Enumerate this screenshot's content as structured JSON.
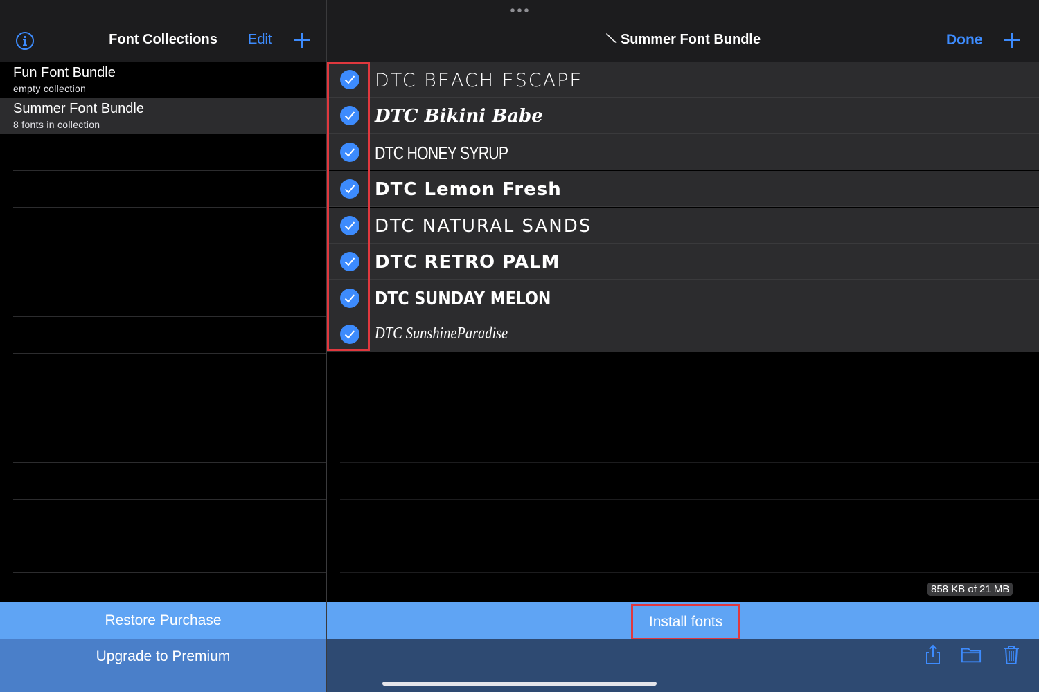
{
  "left_pane": {
    "header": {
      "title": "Font Collections",
      "edit_label": "Edit",
      "info_icon": "info-circle-icon",
      "add_icon": "plus-icon"
    },
    "collections": [
      {
        "name": "Fun Font Bundle",
        "subtitle": "empty collection",
        "selected": false
      },
      {
        "name": "Summer Font Bundle",
        "subtitle": "8 fonts in collection",
        "selected": true
      }
    ],
    "restore_label": "Restore Purchase",
    "upgrade_label": "Upgrade to Premium"
  },
  "right_pane": {
    "header": {
      "title": "Summer Font Bundle",
      "title_icon": "pen-icon",
      "done_label": "Done",
      "add_icon": "plus-icon",
      "more_icon": "ellipsis-icon"
    },
    "fonts": [
      {
        "name": "DTC BEACH ESCAPE",
        "checked": true
      },
      {
        "name": "DTC Bikini Babe",
        "checked": true
      },
      {
        "name": "DTC HONEY SYRUP",
        "checked": true
      },
      {
        "name": "DTC Lemon Fresh",
        "checked": true
      },
      {
        "name": "DTC NATURAL SANDS",
        "checked": true
      },
      {
        "name": "DTC RETRO PALM",
        "checked": true
      },
      {
        "name": "DTC SUNDAY MELON",
        "checked": true
      },
      {
        "name": "DTC SunshineParadise",
        "checked": true
      }
    ],
    "storage": "858 KB of 21 MB",
    "install_label": "Install fonts",
    "toolbar_icons": [
      "share-icon",
      "folder-icon",
      "trash-icon"
    ]
  },
  "colors": {
    "accent": "#3d8bfd",
    "highlight_red": "#e0383e",
    "action_bar": "#5fa4f4",
    "upgrade_bar": "#4a7fc9",
    "toolbar": "#2e4a72"
  }
}
